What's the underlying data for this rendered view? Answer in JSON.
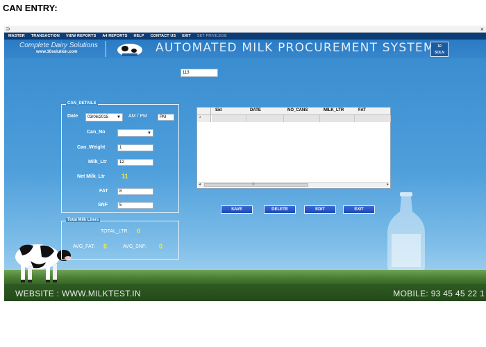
{
  "heading": "CAN ENTRY:",
  "titlebar": {
    "icon": "⊃",
    "close": "×"
  },
  "menu": [
    "MASTER",
    "TRANSACTION",
    "VIEW REPORTS",
    "A4 REPORTS",
    "HELP",
    "CONTACT US",
    "EXIT"
  ],
  "menu_disabled": "SET PRIVILEGE",
  "banner": {
    "tagline": "Complete Dairy Solutions",
    "website": "www.10solution.com",
    "title": "AUTOMATED MILK PROCUREMENT SYSTEM",
    "brand_top": "10",
    "brand_bottom": "SOLN"
  },
  "id_field_value": "113",
  "can_details": {
    "legend": "CAN_DETAILS",
    "date_label": "Date",
    "date_value": "03/06/2015",
    "ampm_label": "AM / PM",
    "ampm_value": "PM",
    "can_no_label": "Can_No",
    "can_no_value": "",
    "can_weight_label": "Can_Weight",
    "can_weight_value": "1",
    "milk_ltr_label": "Milk_Ltr",
    "milk_ltr_value": "12",
    "net_milk_ltr_label": "Net Milk_Ltr",
    "net_milk_ltr_value": "11",
    "fat_label": "FAT",
    "fat_value": "8",
    "snf_label": "SNF",
    "snf_value": "5"
  },
  "grid": {
    "columns": [
      "Sid",
      "DATE",
      "NO_CANS",
      "MILK_LTR",
      "FAT"
    ],
    "new_row_marker": "*"
  },
  "buttons": {
    "save": "SAVE",
    "delete": "DELETE",
    "edit": "EDIT",
    "exit": "EXIT"
  },
  "totals": {
    "legend": "Total Milk Liters",
    "total_ltr_label": "TOTAL_LTR:",
    "total_ltr_value": "0",
    "avg_fat_label": "AVG_FAT:",
    "avg_fat_value": "0",
    "avg_snf_label": "AVG_SNF:",
    "avg_snf_value": "0"
  },
  "footer": {
    "website": "WEBSITE : WWW.MILKTEST.IN",
    "mobile": "MOBILE: 93 45 45 22 1"
  },
  "colors": {
    "menubar": "#0c3d76",
    "sky": "#3d8fcf",
    "button": "#1e48b4",
    "highlight_value": "#f3f135",
    "grass": "#4a7e32"
  }
}
